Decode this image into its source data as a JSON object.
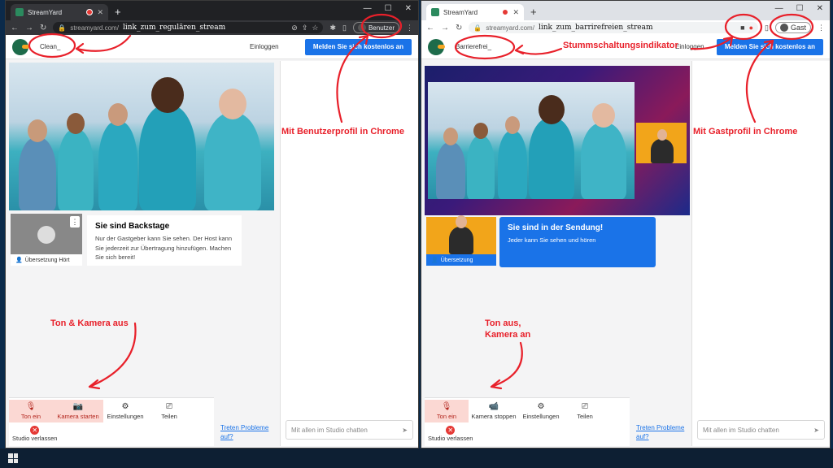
{
  "left": {
    "tab_title": "StreamYard",
    "url_domain": "streamyard.com/",
    "url_path": "link_zum_regulären_stream",
    "profile_label": "Benutzer",
    "room_name": "Clean_",
    "login": "Einloggen",
    "signup": "Melden Sie sich kostenlos an",
    "tile_label": "Übersetzung Hört",
    "status_title": "Sie sind Backstage",
    "status_body": "Nur der Gastgeber kann Sie sehen. Der Host kann Sie jederzeit zur Übertragung hinzufügen. Machen Sie sich bereit!",
    "tools": [
      "Ton ein",
      "Kamera starten",
      "Einstellungen",
      "Teilen"
    ],
    "leave": "Studio verlassen",
    "issues": [
      "Treten Probleme",
      "auf?"
    ],
    "chat_placeholder": "Mit allen im Studio chatten"
  },
  "right": {
    "tab_title": "StreamYard",
    "url_domain": "streamyard.com/",
    "url_path": "link_zum_barrirefreien_stream",
    "profile_label": "Gast",
    "room_name": "Barrierefrei_",
    "login": "Einloggen",
    "signup": "Melden Sie sich kostenlos an",
    "tile_label": "Übersetzung",
    "status_title": "Sie sind in der Sendung!",
    "status_body": "Jeder kann Sie sehen und hören",
    "tools": [
      "Ton ein",
      "Kamera stoppen",
      "Einstellungen",
      "Teilen"
    ],
    "leave": "Studio verlassen",
    "issues": [
      "Treten Probleme",
      "auf?"
    ],
    "chat_placeholder": "Mit allen im Studio chatten"
  },
  "annotations": {
    "user_profile": "Mit Benutzerprofil in Chrome",
    "guest_profile": "Mit Gastprofil in Chrome",
    "mute_indicator": "Stummschaltungsindikator",
    "left_av": "Ton & Kamera aus",
    "right_av_1": "Ton aus,",
    "right_av_2": "Kamera an"
  },
  "colors": {
    "accent": "#1a73e8",
    "annotation": "#e8202a",
    "off_bg": "#fbd8d3"
  }
}
